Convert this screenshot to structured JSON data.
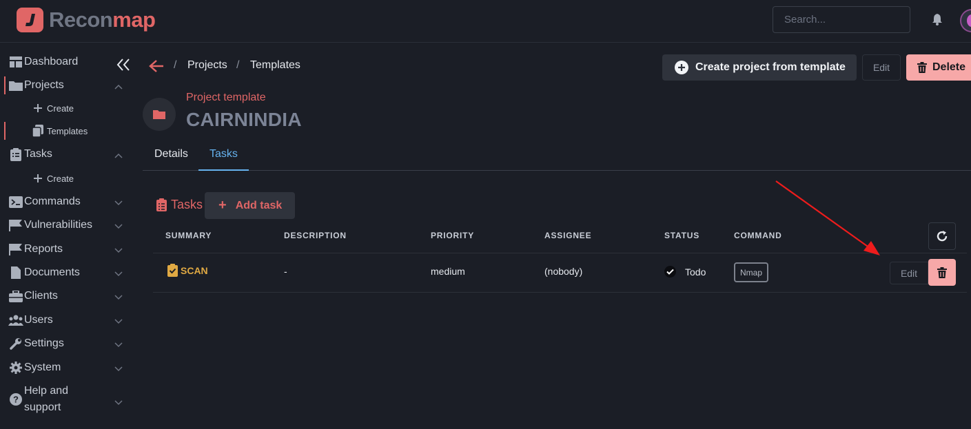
{
  "app": {
    "name_part1": "Recon",
    "name_part2": "map",
    "brand_color": "#e06666"
  },
  "header": {
    "search_placeholder": "Search..."
  },
  "sidebar": {
    "items": [
      {
        "label": "Dashboard",
        "icon": "dashboard-icon"
      },
      {
        "label": "Projects",
        "icon": "folder-icon"
      },
      {
        "label": "Tasks",
        "icon": "clipboard-icon"
      },
      {
        "label": "Commands",
        "icon": "terminal-icon"
      },
      {
        "label": "Vulnerabilities",
        "icon": "flag-icon"
      },
      {
        "label": "Reports",
        "icon": "flag-icon"
      },
      {
        "label": "Documents",
        "icon": "document-icon"
      },
      {
        "label": "Clients",
        "icon": "briefcase-icon"
      },
      {
        "label": "Users",
        "icon": "users-icon"
      },
      {
        "label": "Settings",
        "icon": "wrench-icon"
      },
      {
        "label": "System",
        "icon": "gear-icon"
      },
      {
        "label": "Help and",
        "label2": "support",
        "icon": "help-icon"
      }
    ],
    "projects_sub": [
      {
        "label": "Create"
      },
      {
        "label": "Templates"
      }
    ],
    "tasks_sub": [
      {
        "label": "Create"
      }
    ]
  },
  "breadcrumb": {
    "sep": "/",
    "items": [
      "Projects",
      "Templates"
    ]
  },
  "actions": {
    "create_from_template": "Create project from template",
    "edit": "Edit",
    "delete": "Delete"
  },
  "project": {
    "subtitle": "Project template",
    "title": "CAIRNINDIA"
  },
  "tabs": [
    "Details",
    "Tasks"
  ],
  "tasks_section": {
    "title": "Tasks",
    "add_label": "Add task",
    "columns": [
      "SUMMARY",
      "DESCRIPTION",
      "PRIORITY",
      "ASSIGNEE",
      "STATUS",
      "COMMAND"
    ],
    "rows": [
      {
        "summary": "SCAN",
        "description": "-",
        "priority": "medium",
        "assignee": "(nobody)",
        "status": "Todo",
        "command": "Nmap",
        "edit_label": "Edit"
      }
    ]
  }
}
